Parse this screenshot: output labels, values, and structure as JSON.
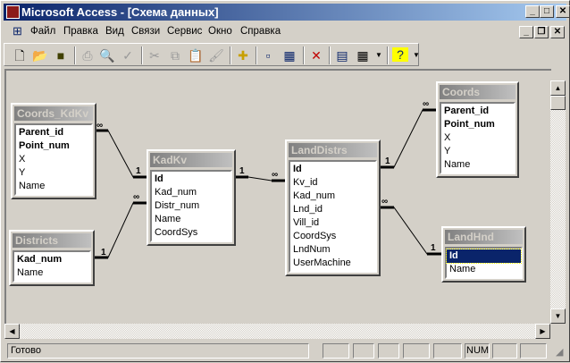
{
  "window": {
    "title": "Microsoft Access - [Схема данных]"
  },
  "menu": [
    "Файл",
    "Правка",
    "Вид",
    "Связи",
    "Сервис",
    "Окно",
    "Справка"
  ],
  "toolbar": [
    "new-icon",
    "open-icon",
    "save-icon",
    "print-icon",
    "print-preview-icon",
    "spelling-icon",
    "cut-icon",
    "copy-icon",
    "paste-icon",
    "format-painter-icon",
    "show-table-icon",
    "show-direct-icon",
    "show-all-icon",
    "delete-icon",
    "database-window-icon",
    "new-object-icon",
    "help-icon"
  ],
  "tables": {
    "coords_kdkv": {
      "title": "Coords_KdKv",
      "fields": [
        "Parent_id",
        "Point_num",
        "X",
        "Y",
        "Name"
      ]
    },
    "districts": {
      "title": "Districts",
      "fields": [
        "Kad_num",
        "Name"
      ]
    },
    "kadkv": {
      "title": "KadKv",
      "fields": [
        "Id",
        "Kad_num",
        "Distr_num",
        "Name",
        "CoordSys"
      ]
    },
    "landdistrs": {
      "title": "LandDistrs",
      "fields": [
        "Id",
        "Kv_id",
        "Kad_num",
        "Lnd_id",
        "Vill_id",
        "CoordSys",
        "LndNum",
        "UserMachine"
      ]
    },
    "coords": {
      "title": "Coords",
      "fields": [
        "Parent_id",
        "Point_num",
        "X",
        "Y",
        "Name"
      ]
    },
    "landhnd": {
      "title": "LandHnd",
      "fields": [
        "Id",
        "Name"
      ]
    }
  },
  "relations": {
    "one": "1",
    "many": "∞"
  },
  "status": {
    "text": "Готово",
    "num": "NUM"
  }
}
